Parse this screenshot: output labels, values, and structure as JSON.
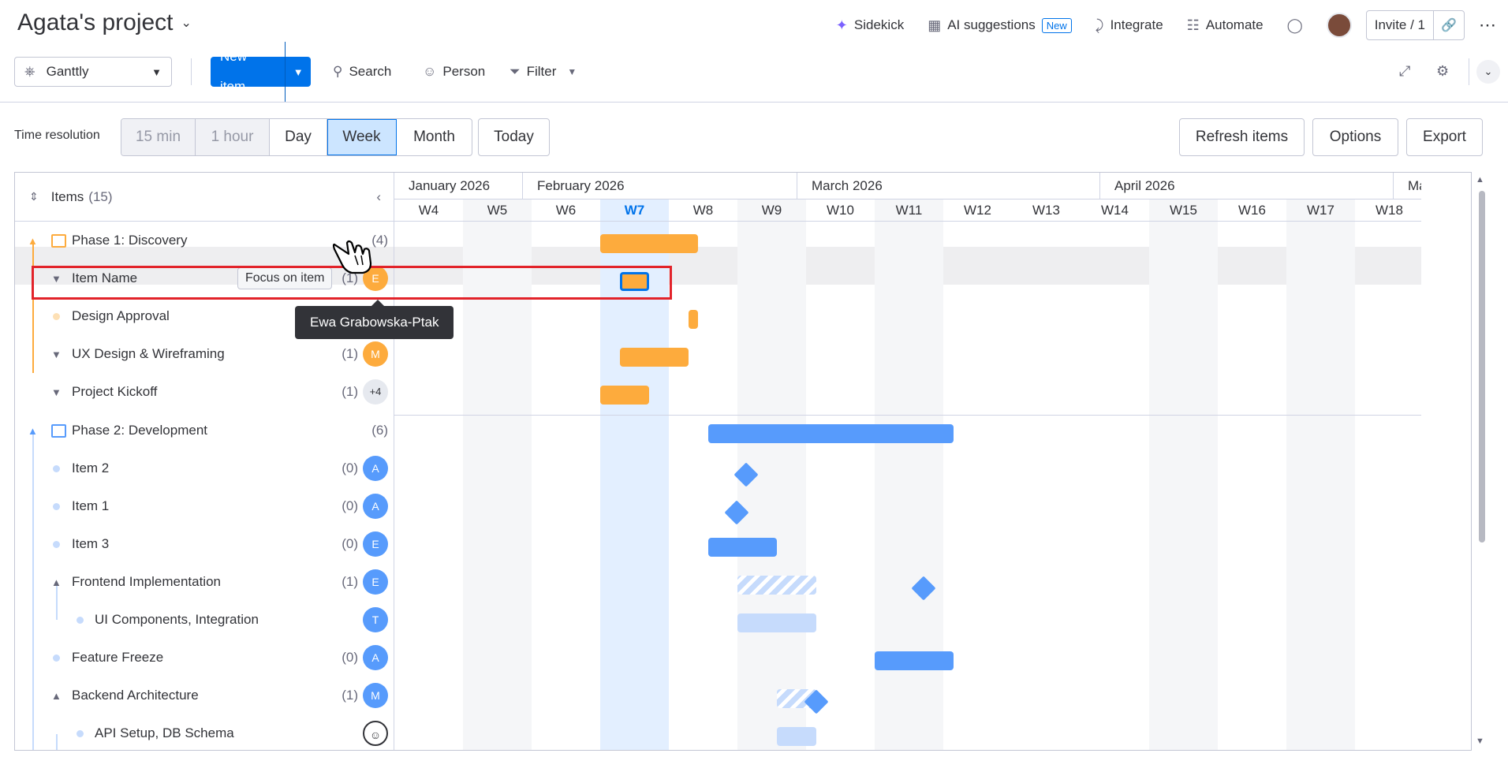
{
  "header": {
    "project_title": "Agata's project",
    "sidekick": "Sidekick",
    "ai_suggestions": "AI suggestions",
    "new_badge": "New",
    "integrate": "Integrate",
    "automate": "Automate",
    "invite": "Invite / 1"
  },
  "toolbar": {
    "view_name": "Ganttly",
    "new_item": "New item",
    "search": "Search",
    "person": "Person",
    "filter": "Filter"
  },
  "resolution": {
    "label": "Time resolution",
    "options": [
      "15 min",
      "1 hour",
      "Day",
      "Week",
      "Month"
    ],
    "selected": "Week",
    "today": "Today",
    "refresh": "Refresh items",
    "options_btn": "Options",
    "export": "Export"
  },
  "gantt": {
    "items_label": "Items",
    "items_count": "(15)",
    "months": [
      "January 2026",
      "February 2026",
      "March 2026",
      "April 2026",
      "Ma"
    ],
    "weeks": [
      "W4",
      "W5",
      "W6",
      "W7",
      "W8",
      "W9",
      "W10",
      "W11",
      "W12",
      "W13",
      "W14",
      "W15",
      "W16",
      "W17",
      "W18"
    ],
    "current_week": "W7",
    "rows": [
      {
        "name": "Phase 1: Discovery",
        "count": "(4)"
      },
      {
        "name": "Item Name",
        "count": "(1)",
        "avatar": "E",
        "focus": "Focus on item"
      },
      {
        "name": "Design Approval"
      },
      {
        "name": "UX Design & Wireframing",
        "count": "(1)",
        "avatar": "M"
      },
      {
        "name": "Project Kickoff",
        "count": "(1)",
        "avatar": "+4"
      },
      {
        "name": "Phase 2: Development",
        "count": "(6)"
      },
      {
        "name": "Item 2",
        "count": "(0)",
        "avatar": "A"
      },
      {
        "name": "Item 1",
        "count": "(0)",
        "avatar": "A"
      },
      {
        "name": "Item 3",
        "count": "(0)",
        "avatar": "E"
      },
      {
        "name": "Frontend Implementation",
        "count": "(1)",
        "avatar": "E"
      },
      {
        "name": "UI Components, Integration",
        "avatar": "T"
      },
      {
        "name": "Feature Freeze",
        "count": "(0)",
        "avatar": "A"
      },
      {
        "name": "Backend Architecture",
        "count": "(1)",
        "avatar": "M"
      },
      {
        "name": "API Setup, DB Schema"
      }
    ]
  },
  "tooltip": "Ewa Grabowska-Ptak",
  "colors": {
    "brand": "#0073ea",
    "phase1": "#fdab3d",
    "phase2": "#579bfc",
    "phase2_light": "#c6dbfc",
    "highlight": "#e2232a"
  }
}
